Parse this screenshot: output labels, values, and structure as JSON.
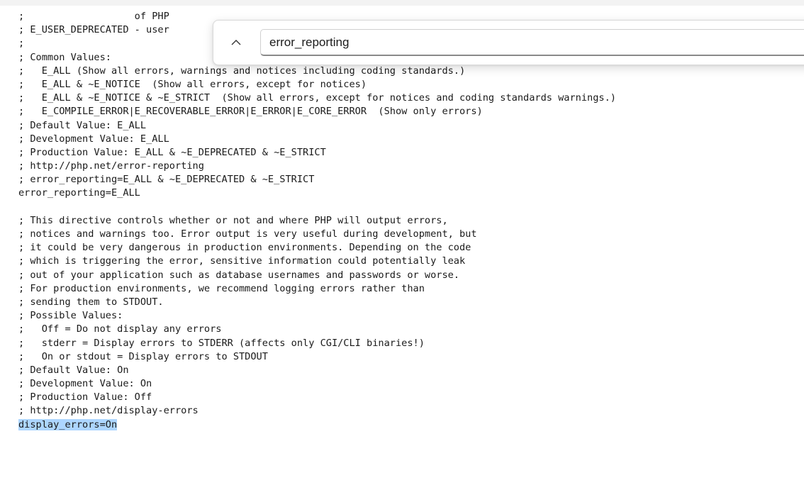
{
  "editor": {
    "lines": [
      ";                   of PHP",
      "; E_USER_DEPRECATED - user",
      ";",
      "; Common Values:",
      ";   E_ALL (Show all errors, warnings and notices including coding standards.)",
      ";   E_ALL & ~E_NOTICE  (Show all errors, except for notices)",
      ";   E_ALL & ~E_NOTICE & ~E_STRICT  (Show all errors, except for notices and coding standards warnings.)",
      ";   E_COMPILE_ERROR|E_RECOVERABLE_ERROR|E_ERROR|E_CORE_ERROR  (Show only errors)",
      "; Default Value: E_ALL",
      "; Development Value: E_ALL",
      "; Production Value: E_ALL & ~E_DEPRECATED & ~E_STRICT",
      "; http://php.net/error-reporting",
      "; error_reporting=E_ALL & ~E_DEPRECATED & ~E_STRICT",
      "error_reporting=E_ALL",
      "",
      "; This directive controls whether or not and where PHP will output errors,",
      "; notices and warnings too. Error output is very useful during development, but",
      "; it could be very dangerous in production environments. Depending on the code",
      "; which is triggering the error, sensitive information could potentially leak",
      "; out of your application such as database usernames and passwords or worse.",
      "; For production environments, we recommend logging errors rather than",
      "; sending them to STDOUT.",
      "; Possible Values:",
      ";   Off = Do not display any errors",
      ";   stderr = Display errors to STDERR (affects only CGI/CLI binaries!)",
      ";   On or stdout = Display errors to STDOUT",
      "; Default Value: On",
      "; Development Value: On",
      "; Production Value: Off",
      "; http://php.net/display-errors",
      "display_errors=On"
    ],
    "highlighted_line": 30
  },
  "find": {
    "query": "error_reporting",
    "prev_icon": "chevron-up-icon"
  }
}
